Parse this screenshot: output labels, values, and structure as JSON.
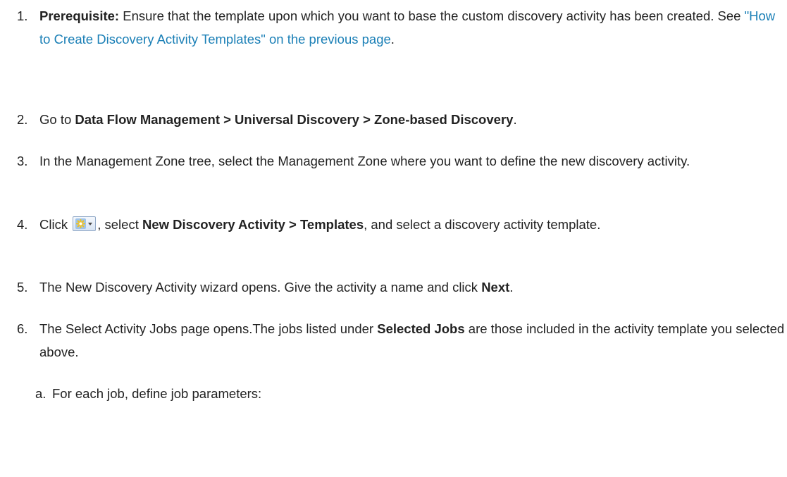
{
  "steps": [
    {
      "num": "1.",
      "prereq_label": "Prerequisite:",
      "text_a": " Ensure that the template upon which you want to base the custom discovery activity has been created. See ",
      "link_text": "\"How to Create Discovery Activity Templates\" on the previous page",
      "text_b": "."
    },
    {
      "num": "2.",
      "text_a": "Go to ",
      "path_bold": "Data Flow Management > Universal Discovery > Zone-based Discovery",
      "text_b": "."
    },
    {
      "num": "3.",
      "text": "In the Management Zone tree, select the Management Zone where you want to define the new discovery activity."
    },
    {
      "num": "4.",
      "text_a": "Click ",
      "icon": "new-activity-dropdown-icon",
      "text_b": ", select ",
      "bold": "New Discovery Activity > Templates",
      "text_c": ", and select a discovery activity template."
    },
    {
      "num": "5.",
      "text_a": "The New Discovery Activity wizard opens. Give the activity a name and click ",
      "bold": "Next",
      "text_b": "."
    },
    {
      "num": "6.",
      "text_a": "The Select Activity Jobs page opens.The jobs listed under ",
      "bold": "Selected Jobs",
      "text_b": " are those included in the activity template you selected above."
    }
  ],
  "substeps": [
    {
      "num": "a.",
      "text": "For each job, define job parameters:"
    }
  ]
}
